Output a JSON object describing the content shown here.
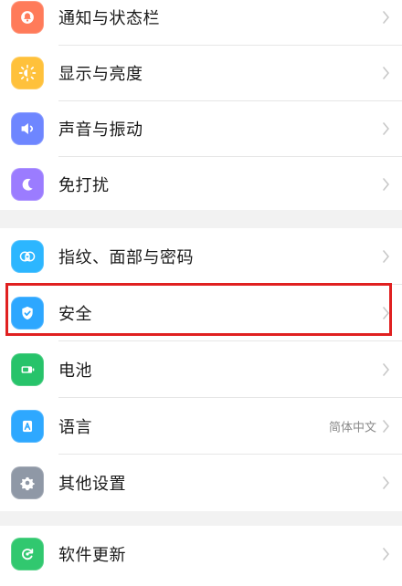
{
  "settings": {
    "items": [
      {
        "label": "通知与状态栏",
        "icon": "notification-icon",
        "color": "#ff7b5a"
      },
      {
        "label": "显示与亮度",
        "icon": "brightness-icon",
        "color": "#ffc13b"
      },
      {
        "label": "声音与振动",
        "icon": "sound-icon",
        "color": "#6e86ff"
      },
      {
        "label": "免打扰",
        "icon": "moon-icon",
        "color": "#9b7cff"
      },
      {
        "label": "指纹、面部与密码",
        "icon": "fingerprint-face-icon",
        "color": "#2cb6ff"
      },
      {
        "label": "安全",
        "icon": "shield-icon",
        "color": "#2da7ff"
      },
      {
        "label": "电池",
        "icon": "battery-icon",
        "color": "#27c36a"
      },
      {
        "label": "语言",
        "icon": "language-icon",
        "color": "#2ea8ff",
        "value": "简体中文"
      },
      {
        "label": "其他设置",
        "icon": "gear-icon",
        "color": "#8f98a6"
      },
      {
        "label": "软件更新",
        "icon": "update-icon",
        "color": "#31c86f"
      }
    ]
  },
  "highlight": {
    "color": "#e02020"
  }
}
